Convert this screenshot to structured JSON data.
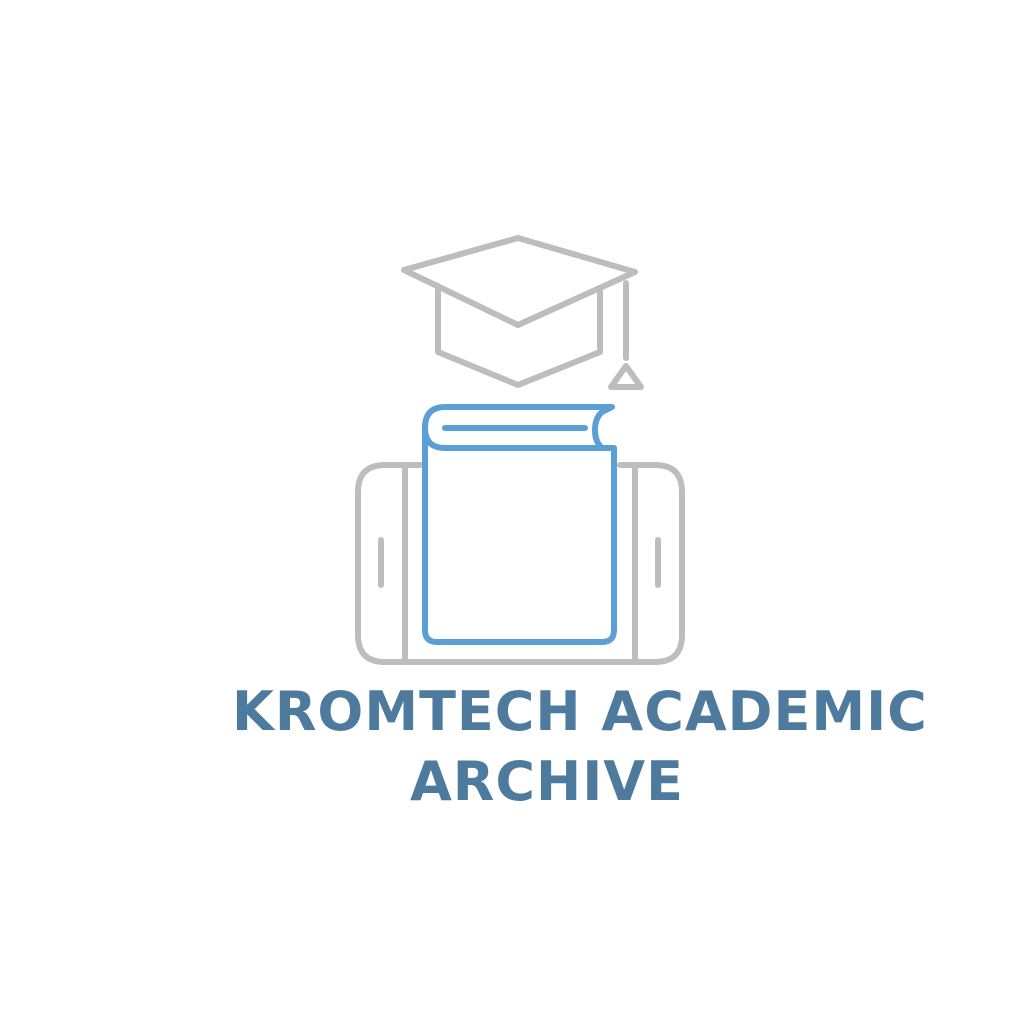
{
  "logo": {
    "title_line1": "KROMTECH ACADEMIC",
    "title_line2": "ARCHIVE",
    "icons": [
      "graduation-cap-icon",
      "book-icon",
      "phone-icon"
    ],
    "colors": {
      "outline_gray": "#bdbdbd",
      "book_blue": "#5a9fd6",
      "text_blue": "#4e7a9d",
      "background": "#ffffff"
    }
  }
}
